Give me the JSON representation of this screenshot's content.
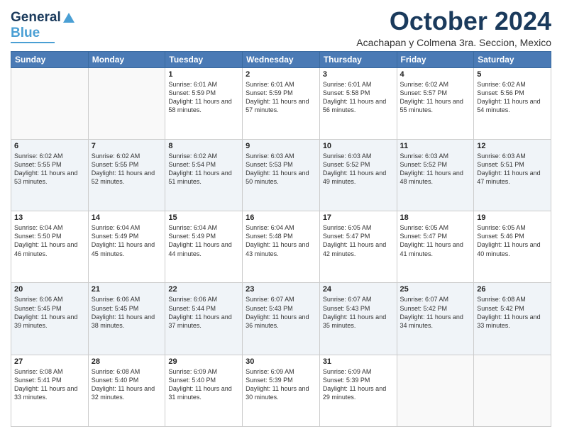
{
  "header": {
    "logo_general": "General",
    "logo_blue": "Blue",
    "month_title": "October 2024",
    "subtitle": "Acachapan y Colmena 3ra. Seccion, Mexico"
  },
  "days_of_week": [
    "Sunday",
    "Monday",
    "Tuesday",
    "Wednesday",
    "Thursday",
    "Friday",
    "Saturday"
  ],
  "weeks": [
    [
      {
        "day": "",
        "info": ""
      },
      {
        "day": "",
        "info": ""
      },
      {
        "day": "1",
        "info": "Sunrise: 6:01 AM\nSunset: 5:59 PM\nDaylight: 11 hours and 58 minutes."
      },
      {
        "day": "2",
        "info": "Sunrise: 6:01 AM\nSunset: 5:59 PM\nDaylight: 11 hours and 57 minutes."
      },
      {
        "day": "3",
        "info": "Sunrise: 6:01 AM\nSunset: 5:58 PM\nDaylight: 11 hours and 56 minutes."
      },
      {
        "day": "4",
        "info": "Sunrise: 6:02 AM\nSunset: 5:57 PM\nDaylight: 11 hours and 55 minutes."
      },
      {
        "day": "5",
        "info": "Sunrise: 6:02 AM\nSunset: 5:56 PM\nDaylight: 11 hours and 54 minutes."
      }
    ],
    [
      {
        "day": "6",
        "info": "Sunrise: 6:02 AM\nSunset: 5:55 PM\nDaylight: 11 hours and 53 minutes."
      },
      {
        "day": "7",
        "info": "Sunrise: 6:02 AM\nSunset: 5:55 PM\nDaylight: 11 hours and 52 minutes."
      },
      {
        "day": "8",
        "info": "Sunrise: 6:02 AM\nSunset: 5:54 PM\nDaylight: 11 hours and 51 minutes."
      },
      {
        "day": "9",
        "info": "Sunrise: 6:03 AM\nSunset: 5:53 PM\nDaylight: 11 hours and 50 minutes."
      },
      {
        "day": "10",
        "info": "Sunrise: 6:03 AM\nSunset: 5:52 PM\nDaylight: 11 hours and 49 minutes."
      },
      {
        "day": "11",
        "info": "Sunrise: 6:03 AM\nSunset: 5:52 PM\nDaylight: 11 hours and 48 minutes."
      },
      {
        "day": "12",
        "info": "Sunrise: 6:03 AM\nSunset: 5:51 PM\nDaylight: 11 hours and 47 minutes."
      }
    ],
    [
      {
        "day": "13",
        "info": "Sunrise: 6:04 AM\nSunset: 5:50 PM\nDaylight: 11 hours and 46 minutes."
      },
      {
        "day": "14",
        "info": "Sunrise: 6:04 AM\nSunset: 5:49 PM\nDaylight: 11 hours and 45 minutes."
      },
      {
        "day": "15",
        "info": "Sunrise: 6:04 AM\nSunset: 5:49 PM\nDaylight: 11 hours and 44 minutes."
      },
      {
        "day": "16",
        "info": "Sunrise: 6:04 AM\nSunset: 5:48 PM\nDaylight: 11 hours and 43 minutes."
      },
      {
        "day": "17",
        "info": "Sunrise: 6:05 AM\nSunset: 5:47 PM\nDaylight: 11 hours and 42 minutes."
      },
      {
        "day": "18",
        "info": "Sunrise: 6:05 AM\nSunset: 5:47 PM\nDaylight: 11 hours and 41 minutes."
      },
      {
        "day": "19",
        "info": "Sunrise: 6:05 AM\nSunset: 5:46 PM\nDaylight: 11 hours and 40 minutes."
      }
    ],
    [
      {
        "day": "20",
        "info": "Sunrise: 6:06 AM\nSunset: 5:45 PM\nDaylight: 11 hours and 39 minutes."
      },
      {
        "day": "21",
        "info": "Sunrise: 6:06 AM\nSunset: 5:45 PM\nDaylight: 11 hours and 38 minutes."
      },
      {
        "day": "22",
        "info": "Sunrise: 6:06 AM\nSunset: 5:44 PM\nDaylight: 11 hours and 37 minutes."
      },
      {
        "day": "23",
        "info": "Sunrise: 6:07 AM\nSunset: 5:43 PM\nDaylight: 11 hours and 36 minutes."
      },
      {
        "day": "24",
        "info": "Sunrise: 6:07 AM\nSunset: 5:43 PM\nDaylight: 11 hours and 35 minutes."
      },
      {
        "day": "25",
        "info": "Sunrise: 6:07 AM\nSunset: 5:42 PM\nDaylight: 11 hours and 34 minutes."
      },
      {
        "day": "26",
        "info": "Sunrise: 6:08 AM\nSunset: 5:42 PM\nDaylight: 11 hours and 33 minutes."
      }
    ],
    [
      {
        "day": "27",
        "info": "Sunrise: 6:08 AM\nSunset: 5:41 PM\nDaylight: 11 hours and 33 minutes."
      },
      {
        "day": "28",
        "info": "Sunrise: 6:08 AM\nSunset: 5:40 PM\nDaylight: 11 hours and 32 minutes."
      },
      {
        "day": "29",
        "info": "Sunrise: 6:09 AM\nSunset: 5:40 PM\nDaylight: 11 hours and 31 minutes."
      },
      {
        "day": "30",
        "info": "Sunrise: 6:09 AM\nSunset: 5:39 PM\nDaylight: 11 hours and 30 minutes."
      },
      {
        "day": "31",
        "info": "Sunrise: 6:09 AM\nSunset: 5:39 PM\nDaylight: 11 hours and 29 minutes."
      },
      {
        "day": "",
        "info": ""
      },
      {
        "day": "",
        "info": ""
      }
    ]
  ]
}
